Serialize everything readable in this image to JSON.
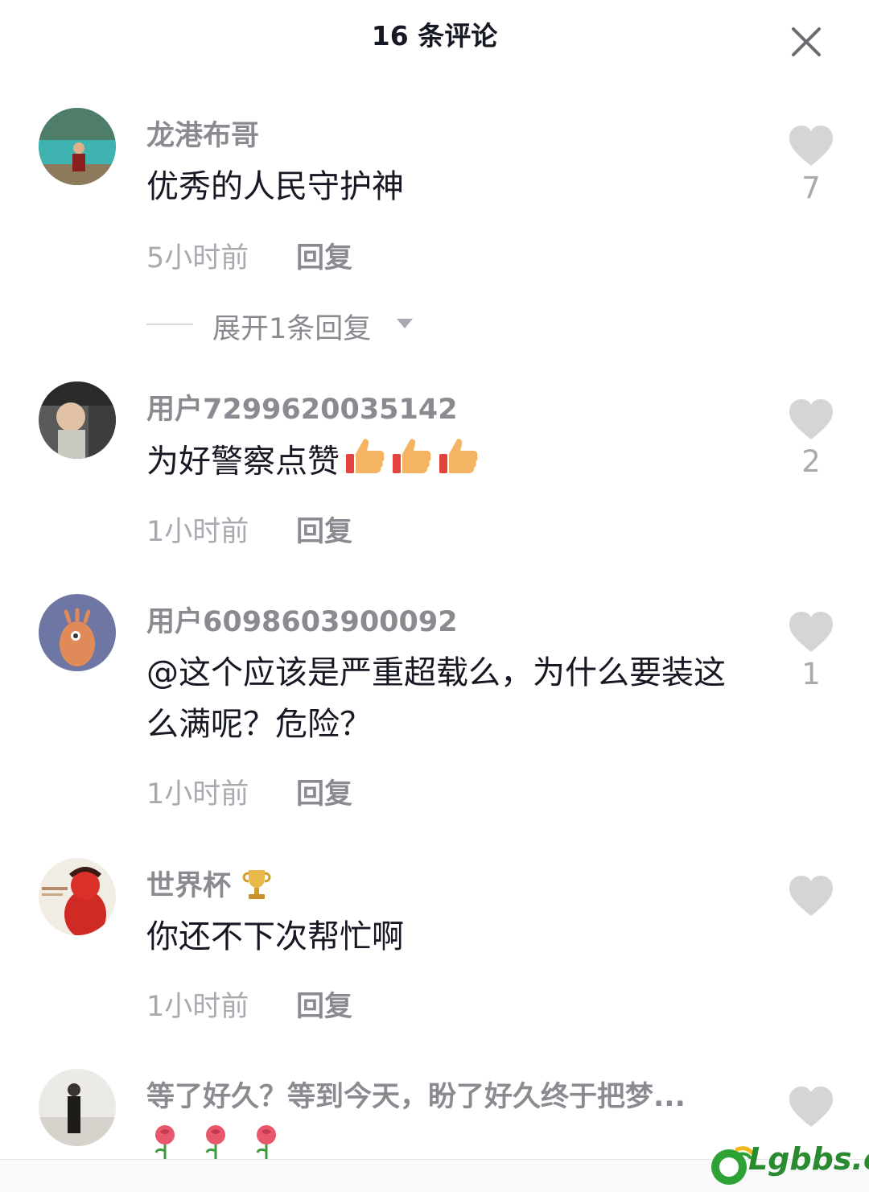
{
  "header": {
    "title": "16 条评论",
    "close_icon": "close-icon"
  },
  "comments": [
    {
      "username": "龙港布哥",
      "text": "优秀的人民守护神",
      "time": "5小时前",
      "reply_label": "回复",
      "likes": "7",
      "expand_label": "展开1条回复"
    },
    {
      "username": "用户7299620035142",
      "text": "为好警察点赞",
      "emoji": [
        "thumbs-up-icon",
        "thumbs-up-icon",
        "thumbs-up-icon"
      ],
      "time": "1小时前",
      "reply_label": "回复",
      "likes": "2"
    },
    {
      "username": "用户6098603900092",
      "text": "@这个应该是严重超载么，为什么要装这么满呢？危险？",
      "time": "1小时前",
      "reply_label": "回复",
      "likes": "1"
    },
    {
      "username": "世界杯",
      "badge": "trophy-icon",
      "text": "你还不下次帮忙啊",
      "time": "1小时前",
      "reply_label": "回复",
      "likes": ""
    },
    {
      "username": "等了好久？等到今天，盼了好久终于把梦...",
      "emoji": [
        "rose-icon",
        "rose-icon",
        "rose-icon"
      ]
    }
  ],
  "watermark": {
    "text": "Lgbbs.cn"
  },
  "colors": {
    "like_gray": "#d5d5d8",
    "secondary_text": "#8a8b91",
    "meta_text": "#a9aab0",
    "watermark_green": "#2a8a2f"
  }
}
